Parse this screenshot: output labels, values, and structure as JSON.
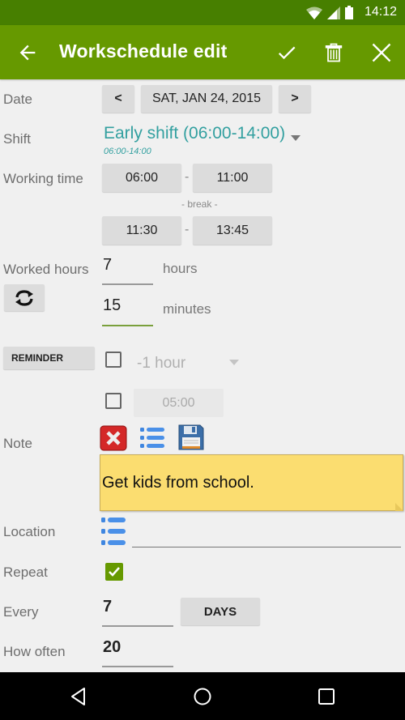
{
  "status_bar": {
    "time": "14:12",
    "icons": [
      "wifi-icon",
      "signal-icon",
      "battery-icon"
    ]
  },
  "app_bar": {
    "title": "Workschedule edit",
    "back_icon": "arrow-left-icon",
    "actions": [
      "check-icon",
      "trash-icon",
      "close-icon"
    ],
    "color": "#669900"
  },
  "form": {
    "date": {
      "label": "Date",
      "prev": "<",
      "value": "SAT, JAN 24, 2015",
      "next": ">"
    },
    "shift": {
      "label": "Shift",
      "selected": "Early shift (06:00-14:00)",
      "subtitle": "06:00-14:00"
    },
    "working_time": {
      "label": "Working time",
      "start": "06:00",
      "separator": "-",
      "end": "11:00",
      "break_label": "- break -",
      "break_start": "11:30",
      "break_end": "13:45"
    },
    "worked_hours": {
      "label": "Worked hours",
      "hours_value": "7",
      "hours_unit": "hours",
      "minutes_value": "15",
      "minutes_unit": "minutes",
      "refresh_icon": "refresh-icon"
    },
    "reminder": {
      "button_label": "REMINDER",
      "offset_checked": false,
      "offset_value": "-1 hour",
      "time_checked": false,
      "time_value": "05:00"
    },
    "note": {
      "label": "Note",
      "icons": [
        "delete-red-icon",
        "list-icon",
        "save-floppy-icon"
      ],
      "text": "Get kids from school."
    },
    "location": {
      "label": "Location",
      "icon": "list-icon",
      "value": ""
    },
    "repeat": {
      "label": "Repeat",
      "checked": true
    },
    "every": {
      "label": "Every",
      "value": "7",
      "unit_button": "DAYS"
    },
    "how_often": {
      "label": "How often",
      "value": "20"
    }
  },
  "nav_bar": {
    "buttons": [
      "back-triangle-icon",
      "home-circle-icon",
      "recents-square-icon"
    ]
  }
}
